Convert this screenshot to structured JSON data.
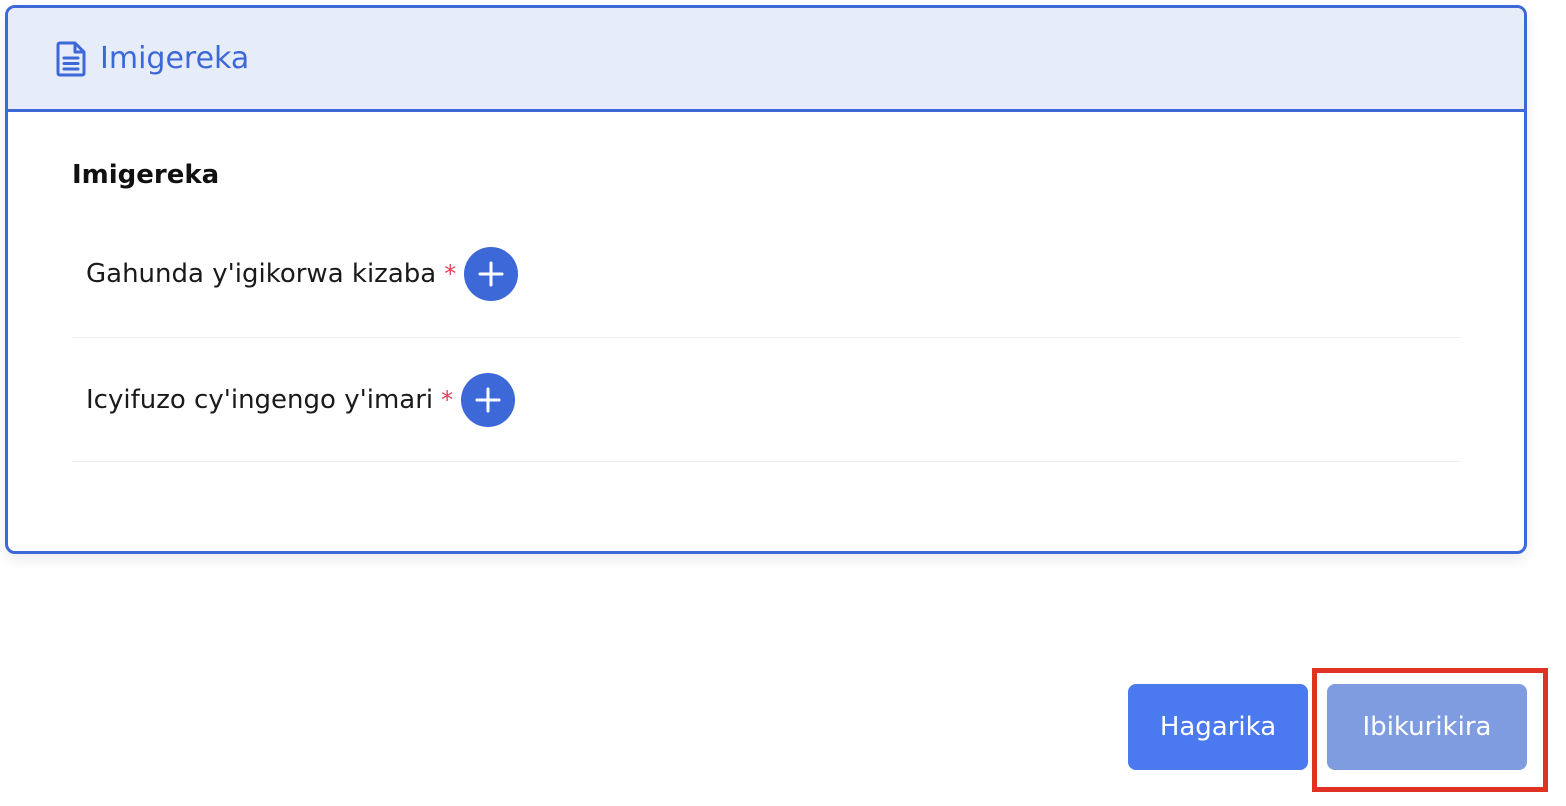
{
  "header": {
    "title": "Imigereka",
    "icon": "document-icon"
  },
  "section": {
    "title": "Imigereka"
  },
  "documents": [
    {
      "label": "Gahunda y'igikorwa kizaba",
      "required_mark": "*",
      "action_icon": "plus-icon"
    },
    {
      "label": "Icyifuzo cy'ingengo y'imari",
      "required_mark": "*",
      "action_icon": "plus-icon"
    }
  ],
  "buttons": {
    "cancel_label": "Hagarika",
    "next_label": "Ibikurikira"
  },
  "colors": {
    "accent": "#3d68d8",
    "header_bg": "#e6edf9",
    "cancel_bg": "#4a79f0",
    "next_bg": "#7f9ce0",
    "required": "#e0405a",
    "highlight": "#e03222"
  }
}
